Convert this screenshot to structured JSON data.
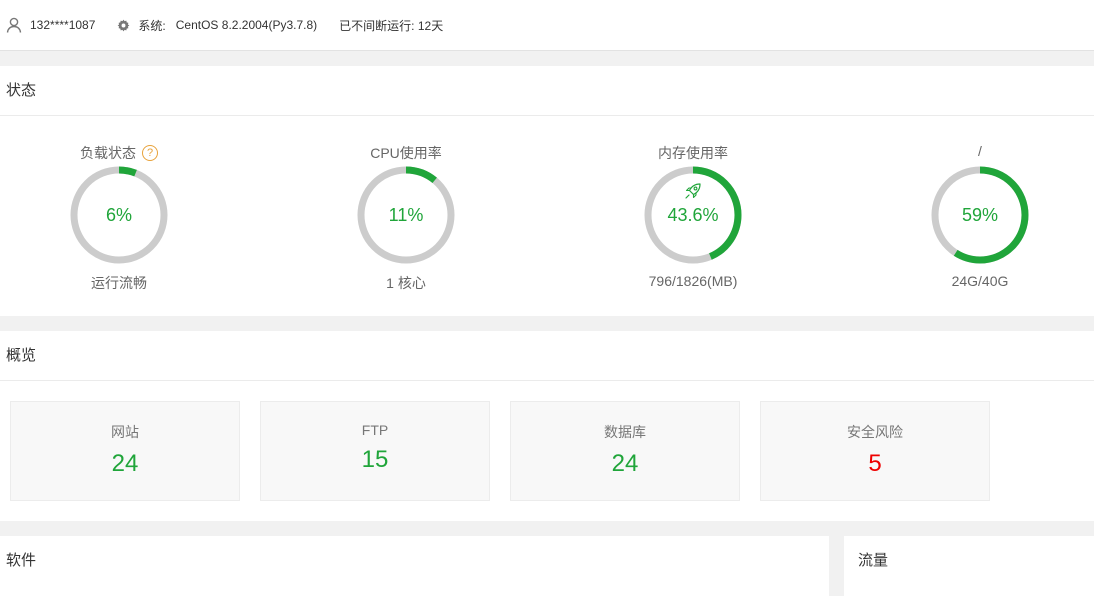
{
  "header": {
    "user": "132****1087",
    "system_label": "系统:",
    "system_value": "CentOS 8.2.2004(Py3.7.8)",
    "uptime": "已不间断运行: 12天"
  },
  "status": {
    "title": "状态",
    "gauges": [
      {
        "title": "负载状态",
        "value": "6%",
        "percent": 6,
        "sub": "运行流畅",
        "help": "?"
      },
      {
        "title": "CPU使用率",
        "value": "11%",
        "percent": 11,
        "sub": "1 核心"
      },
      {
        "title": "内存使用率",
        "value": "43.6%",
        "percent": 43.6,
        "sub": "796/1826(MB)"
      },
      {
        "title": "/",
        "value": "59%",
        "percent": 59,
        "sub": "24G/40G"
      }
    ]
  },
  "overview": {
    "title": "概览",
    "cards": [
      {
        "label": "网站",
        "value": "24"
      },
      {
        "label": "FTP",
        "value": "15"
      },
      {
        "label": "数据库",
        "value": "24"
      },
      {
        "label": "安全风险",
        "value": "5"
      }
    ]
  },
  "software": {
    "title": "软件"
  },
  "traffic": {
    "title": "流量"
  },
  "colors": {
    "accent": "#20a53a",
    "track": "#cccccc",
    "risk": "#ee0000",
    "help": "#e8a33c"
  }
}
